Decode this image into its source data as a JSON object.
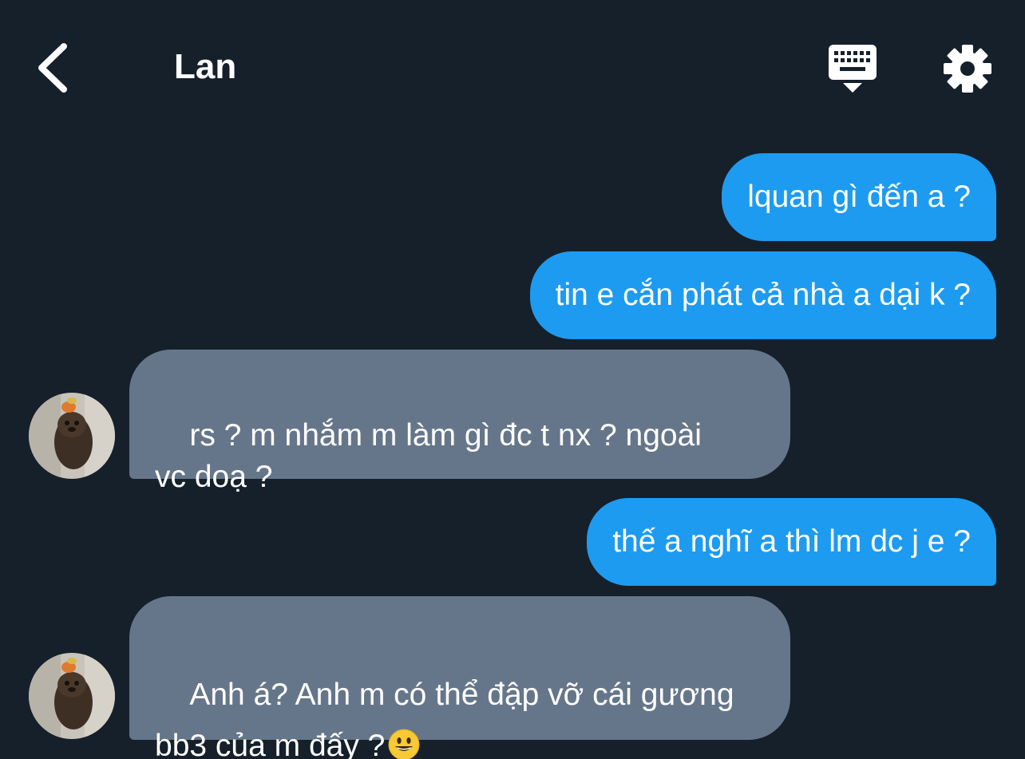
{
  "header": {
    "back_icon": "chevron-left-icon",
    "title": "Lan",
    "keyboard_icon": "keyboard-icon",
    "settings_icon": "gear-icon"
  },
  "messages": [
    {
      "side": "sent",
      "text": "lquan gì đến a ?"
    },
    {
      "side": "sent",
      "text": "tin e cắn phát cả nhà a dại k ?"
    },
    {
      "side": "received",
      "text": "rs ? m nhắm m làm gì đc t nx ? ngoài\nvc doạ ?"
    },
    {
      "side": "sent",
      "text": "thế a nghĩ a thì lm dc j e ?"
    },
    {
      "side": "received",
      "text": "Anh á? Anh m có thể đập vỡ cái gương\nbb3 của m đấy ?",
      "emoji": "grinning-face-emoji"
    }
  ],
  "colors": {
    "background": "#15202b",
    "sent_bubble": "#1d9bf0",
    "received_bubble": "#66768a",
    "text": "#ffffff"
  }
}
